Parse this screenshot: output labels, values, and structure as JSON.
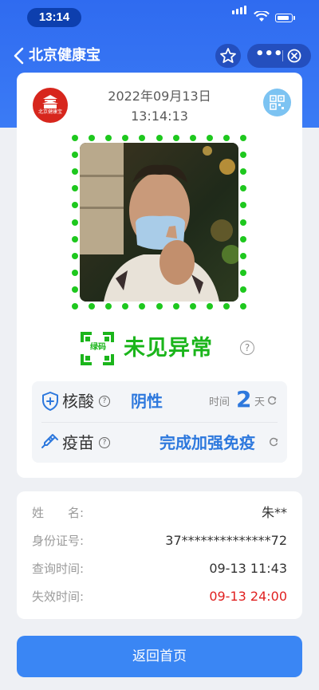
{
  "status_bar": {
    "time": "13:14"
  },
  "nav": {
    "title": "北京健康宝",
    "more_label": "•••"
  },
  "brand": {
    "logo_text": "北京健康宝"
  },
  "header": {
    "date": "2022年09月13日",
    "time": "13:14:13"
  },
  "health_code": {
    "qr_label": "绿码",
    "status": "未见异常",
    "help_label": "?",
    "color": "#1bb51b"
  },
  "nucleic": {
    "label": "核酸",
    "help": "?",
    "result": "阴性",
    "time_label": "时间",
    "days_value": "2",
    "days_unit": "天"
  },
  "vaccine": {
    "label": "疫苗",
    "help": "?",
    "status": "完成加强免疫"
  },
  "info": [
    {
      "label": "姓　　名:",
      "value": "朱**"
    },
    {
      "label": "身份证号:",
      "value": "37**************72"
    },
    {
      "label": "查询时间:",
      "value": "09-13 11:43"
    },
    {
      "label": "失效时间:",
      "value": "09-13 24:00"
    }
  ],
  "actions": {
    "back_home": "返回首页"
  },
  "colors": {
    "primary": "#2f6bf0",
    "accent_blue": "#2d78dd",
    "warning_red": "#e02020"
  }
}
